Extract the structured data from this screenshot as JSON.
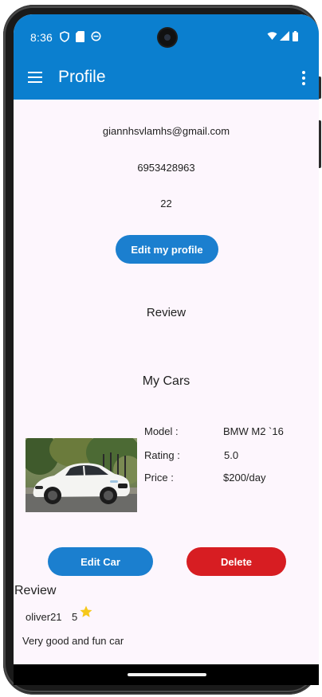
{
  "status_bar": {
    "time": "8:36",
    "left_icons": [
      "shield-check-icon",
      "sd-card-icon",
      "sync-circle-icon"
    ],
    "right_icons": [
      "wifi-icon",
      "cellular-icon",
      "battery-icon"
    ]
  },
  "app_bar": {
    "title": "Profile",
    "menu_icon": "hamburger-menu-icon",
    "overflow_icon": "more-vertical-icon"
  },
  "profile": {
    "email": "giannhsvlamhs@gmail.com",
    "phone": "6953428963",
    "age": "22",
    "edit_button": "Edit my profile",
    "review_link": "Review"
  },
  "my_cars": {
    "title": "My Cars",
    "car": {
      "model_label": "Model :",
      "model_value": "BMW M2 `16",
      "rating_label": "Rating :",
      "rating_value": "5.0",
      "price_label": "Price :",
      "price_value": "$200/day"
    },
    "edit_button": "Edit Car",
    "delete_button": "Delete"
  },
  "review": {
    "title": "Review",
    "user": "oliver21",
    "rating": "5",
    "text": "Very good and fun car"
  },
  "colors": {
    "primary": "#0b7fcf",
    "danger": "#d71d22",
    "star": "#f6c81a",
    "background": "#fdf6fd"
  }
}
